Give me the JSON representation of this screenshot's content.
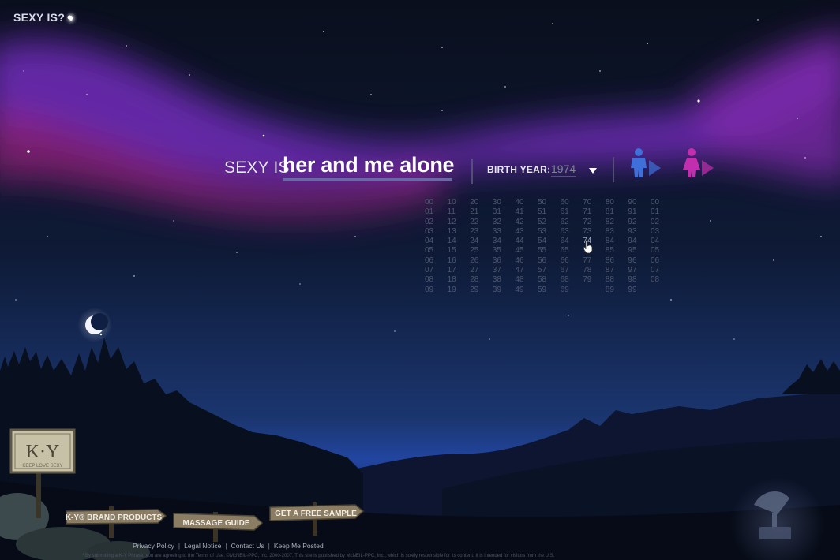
{
  "header": {
    "title": "SEXY IS?"
  },
  "prompt": {
    "label": "SEXY IS",
    "answer": "her and me alone"
  },
  "birth_year": {
    "label": "BIRTH YEAR:",
    "value": "1974"
  },
  "gender": {
    "male_color": "#3f6fd9",
    "female_color": "#c22fae"
  },
  "year_grid": {
    "columns": [
      [
        "00",
        "01",
        "02",
        "03",
        "04",
        "05",
        "06",
        "07",
        "08",
        "09"
      ],
      [
        "10",
        "11",
        "12",
        "13",
        "14",
        "15",
        "16",
        "17",
        "18",
        "19"
      ],
      [
        "20",
        "21",
        "22",
        "23",
        "24",
        "25",
        "26",
        "27",
        "28",
        "29"
      ],
      [
        "30",
        "31",
        "32",
        "33",
        "34",
        "35",
        "36",
        "37",
        "38",
        "39"
      ],
      [
        "40",
        "41",
        "42",
        "43",
        "44",
        "45",
        "46",
        "47",
        "48",
        "49"
      ],
      [
        "50",
        "51",
        "52",
        "53",
        "54",
        "55",
        "56",
        "57",
        "58",
        "59"
      ],
      [
        "60",
        "61",
        "62",
        "63",
        "64",
        "65",
        "66",
        "67",
        "68",
        "69"
      ],
      [
        "70",
        "71",
        "72",
        "73",
        "74",
        "76",
        "77",
        "78",
        "79"
      ],
      [
        "80",
        "81",
        "82",
        "83",
        "84",
        "85",
        "86",
        "87",
        "88",
        "89"
      ],
      [
        "90",
        "91",
        "92",
        "93",
        "94",
        "95",
        "96",
        "97",
        "98",
        "99"
      ],
      [
        "00",
        "01",
        "02",
        "03",
        "04",
        "05",
        "06",
        "07",
        "08"
      ]
    ],
    "selected": "74"
  },
  "logo": {
    "brand": "K·Y",
    "tagline": "KEEP LOVE SEXY"
  },
  "signposts": {
    "brand_products": "K-Y® BRAND PRODUCTS",
    "massage_guide": "MASSAGE GUIDE",
    "free_sample": "GET A FREE SAMPLE"
  },
  "footer": {
    "links": [
      "Privacy Policy",
      "Legal Notice",
      "Contact Us",
      "Keep Me Posted"
    ],
    "separator": "|",
    "disclaimer": "* By submitting a K-Y Phrase, you are agreeing to the Terms of Use. ©McNEIL-PPC, Inc. 2000-2007. This site is published by McNEIL-PPC, Inc., which is solely responsible for its content. It is intended for visitors from the U.S."
  },
  "colors": {
    "sky_top": "#0a0f1d",
    "sky_bottom": "#1f3f82",
    "aurora": "#7a2fb0",
    "answer_underline": "#6a68a6"
  }
}
